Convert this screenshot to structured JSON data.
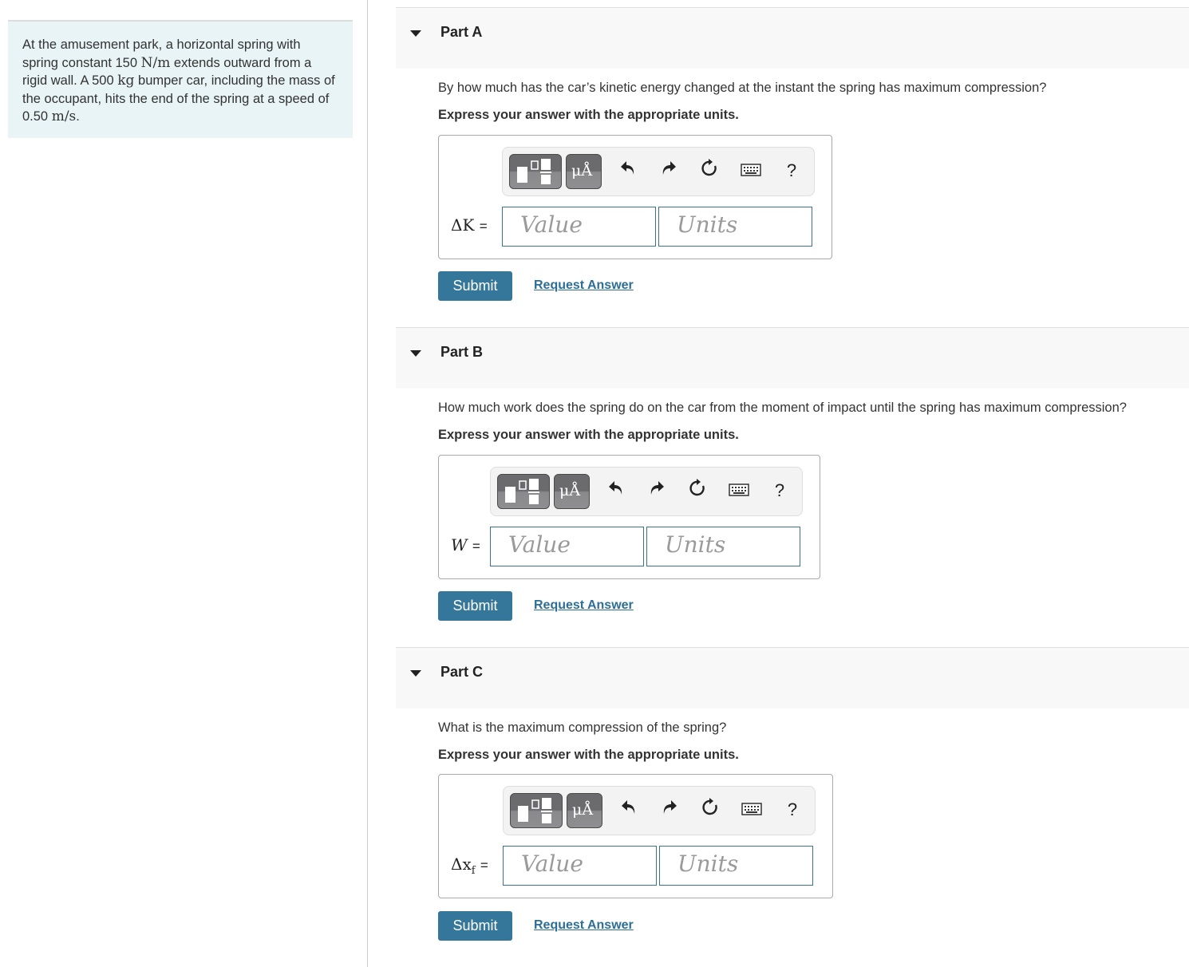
{
  "problem": {
    "segments": [
      {
        "t": "At the amusement park, a horizontal spring with spring constant 150 ",
        "m": false
      },
      {
        "t": "N/m",
        "m": true
      },
      {
        "t": " extends outward from a rigid wall. A 500 ",
        "m": false
      },
      {
        "t": "kg",
        "m": true
      },
      {
        "t": " bumper car, including the mass of the occupant, hits the end of the spring at a speed of 0.50 ",
        "m": false
      },
      {
        "t": "m/s",
        "m": true
      },
      {
        "t": ".",
        "m": false
      }
    ]
  },
  "toolbar": {
    "template_icon": "fraction-template-icon",
    "units_label": "μÅ",
    "undo_icon": "↶",
    "redo_icon": "↷",
    "reset_icon": "↻",
    "keyboard_icon": "⌨",
    "help_label": "?"
  },
  "parts": [
    {
      "title": "Part A",
      "question": "By how much has the car’s kinetic energy changed at the instant the spring has maximum compression?",
      "instruction": "Express your answer with the appropriate units.",
      "variable": "ΔK",
      "equals": "=",
      "value_placeholder": "Value",
      "units_placeholder": "Units",
      "submit_label": "Submit",
      "request_label": "Request Answer"
    },
    {
      "title": "Part B",
      "question": "How much work does the spring do on the car from the moment of impact until the spring has maximum compression?",
      "instruction": "Express your answer with the appropriate units.",
      "variable": "W",
      "equals": "=",
      "value_placeholder": "Value",
      "units_placeholder": "Units",
      "submit_label": "Submit",
      "request_label": "Request Answer"
    },
    {
      "title": "Part C",
      "question": "What is the maximum compression of the spring?",
      "instruction": "Express your answer with the appropriate units.",
      "variable": "Δx",
      "variable_sub": "f",
      "equals": "=",
      "value_placeholder": "Value",
      "units_placeholder": "Units",
      "submit_label": "Submit",
      "request_label": "Request Answer"
    }
  ],
  "colors": {
    "accent": "#35779a",
    "link": "#2c6e97",
    "input_border": "#3a7290",
    "problem_bg": "#e8f4f6",
    "header_bg": "#f8f8f8"
  }
}
